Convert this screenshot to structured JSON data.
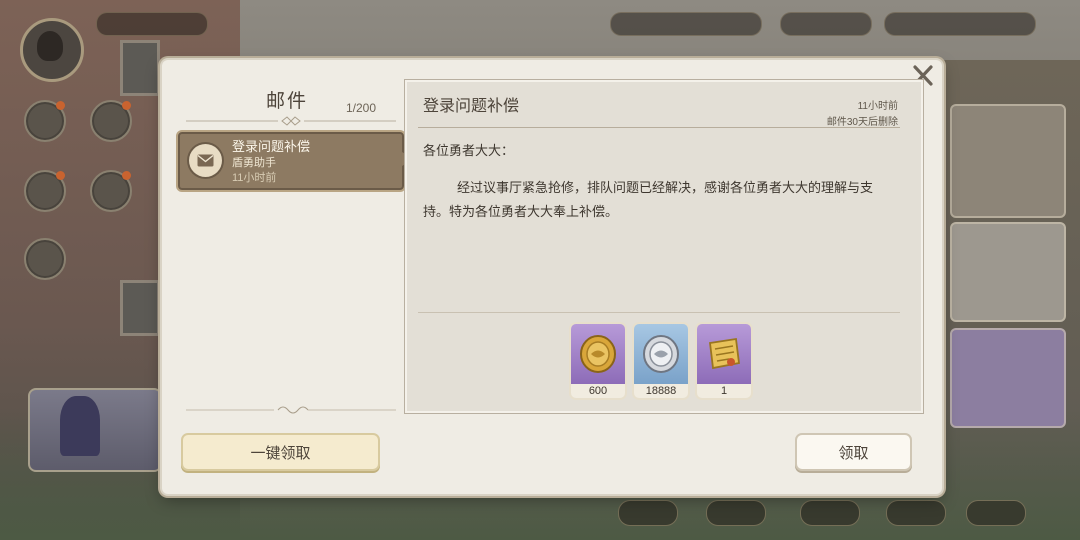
{
  "mailbox": {
    "title": "邮件",
    "count": "1/200",
    "items": [
      {
        "title": "登录问题补偿",
        "sender": "盾勇助手",
        "time": "11小时前"
      }
    ],
    "claim_all_label": "一键领取"
  },
  "detail": {
    "title": "登录问题补偿",
    "time": "11小时前",
    "expire_note": "邮件30天后删除",
    "greeting": "各位勇者大大：",
    "body": "经过议事厅紧急抢修，排队问题已经解决，感谢各位勇者大大的理解与支持。特为各位勇者大大奉上补偿。",
    "rewards": [
      {
        "icon": "gold-coin-icon",
        "quantity": "600",
        "frame_color": "#8d6cb8"
      },
      {
        "icon": "silver-coin-icon",
        "quantity": "18888",
        "frame_color": "#7aa2c9"
      },
      {
        "icon": "scroll-ticket-icon",
        "quantity": "1",
        "frame_color": "#8d6cb8"
      }
    ],
    "claim_label": "领取"
  },
  "colors": {
    "accent_brown": "#8d7a62",
    "dialog_bg": "#efece4",
    "text_dark": "#4d443a"
  }
}
